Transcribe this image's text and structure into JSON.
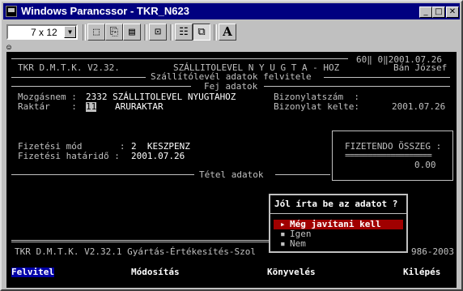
{
  "window": {
    "title": "Windows Parancssor - TKR_N623"
  },
  "toolbar": {
    "font_size": "7 x 12",
    "buttons": [
      {
        "name": "mark-icon",
        "glyph": "⬚"
      },
      {
        "name": "copy-icon",
        "glyph": "⎘"
      },
      {
        "name": "paste-icon",
        "glyph": "📋"
      },
      {
        "name": "fullscreen-icon",
        "glyph": "⊡"
      },
      {
        "name": "properties-icon",
        "glyph": "☷"
      },
      {
        "name": "background-icon",
        "glyph": "⧉"
      },
      {
        "name": "font-icon",
        "glyph": "A"
      }
    ]
  },
  "screen": {
    "top_right_counters": "60‖ 0‖2001.07.26",
    "app_version": "TKR D.M.T.K. V2.32.",
    "module_title": "SZÁLLITOLEVEL N Y U G T A - HOZ",
    "user_name": "Bán József",
    "subtitle": "Szállítólevél adatok felvitele",
    "section_header": "Fej adatok",
    "mozgasnem_label": "Mozgásnem :",
    "mozgasnem_value": "2332 SZÁLLITOLEVEL NYUGTAHOZ",
    "raktar_label": "Raktár    :",
    "raktar_code": "11",
    "raktar_name": "ARURAKTAR",
    "bizonylatszam_label": "Bizonylatszám  :",
    "bizonylat_kelte_label": "Bizonylat kelte:",
    "bizonylat_kelte_value": "2001.07.26",
    "fizetesi_mod_label": "Fizetési mód       :",
    "fizetesi_mod_value": "2  KESZPENZ",
    "fizetesi_hatarido_label": "Fizetési határidő :",
    "fizetesi_hatarido_value": "2001.07.26",
    "osszeg_label": "FIZETENDO ÖSSZEG :",
    "osszeg_sep": "===================",
    "osszeg_value": "0.00",
    "tetel_header": "Tétel adatok",
    "footer_left": "TKR D.M.T.K. V2.32.1 Gyártás-Értékesítés-Szol",
    "footer_right": "986-2003"
  },
  "dialog": {
    "title": "Jól írta be az adatot ?",
    "options": [
      "Még javítani kell",
      "Igen",
      "Nem"
    ]
  },
  "menu": {
    "items": [
      "Felvitel",
      "Módosítás",
      "Könyvelés",
      "Kilépés"
    ]
  }
}
